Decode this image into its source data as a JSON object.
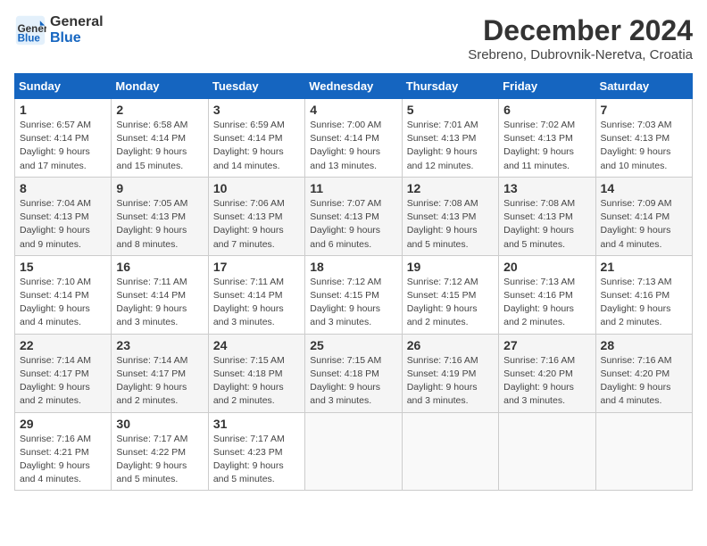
{
  "header": {
    "logo_line1": "General",
    "logo_line2": "Blue",
    "month": "December 2024",
    "location": "Srebreno, Dubrovnik-Neretva, Croatia"
  },
  "days_of_week": [
    "Sunday",
    "Monday",
    "Tuesday",
    "Wednesday",
    "Thursday",
    "Friday",
    "Saturday"
  ],
  "weeks": [
    [
      {
        "day": "1",
        "info": "Sunrise: 6:57 AM\nSunset: 4:14 PM\nDaylight: 9 hours\nand 17 minutes."
      },
      {
        "day": "2",
        "info": "Sunrise: 6:58 AM\nSunset: 4:14 PM\nDaylight: 9 hours\nand 15 minutes."
      },
      {
        "day": "3",
        "info": "Sunrise: 6:59 AM\nSunset: 4:14 PM\nDaylight: 9 hours\nand 14 minutes."
      },
      {
        "day": "4",
        "info": "Sunrise: 7:00 AM\nSunset: 4:14 PM\nDaylight: 9 hours\nand 13 minutes."
      },
      {
        "day": "5",
        "info": "Sunrise: 7:01 AM\nSunset: 4:13 PM\nDaylight: 9 hours\nand 12 minutes."
      },
      {
        "day": "6",
        "info": "Sunrise: 7:02 AM\nSunset: 4:13 PM\nDaylight: 9 hours\nand 11 minutes."
      },
      {
        "day": "7",
        "info": "Sunrise: 7:03 AM\nSunset: 4:13 PM\nDaylight: 9 hours\nand 10 minutes."
      }
    ],
    [
      {
        "day": "8",
        "info": "Sunrise: 7:04 AM\nSunset: 4:13 PM\nDaylight: 9 hours\nand 9 minutes."
      },
      {
        "day": "9",
        "info": "Sunrise: 7:05 AM\nSunset: 4:13 PM\nDaylight: 9 hours\nand 8 minutes."
      },
      {
        "day": "10",
        "info": "Sunrise: 7:06 AM\nSunset: 4:13 PM\nDaylight: 9 hours\nand 7 minutes."
      },
      {
        "day": "11",
        "info": "Sunrise: 7:07 AM\nSunset: 4:13 PM\nDaylight: 9 hours\nand 6 minutes."
      },
      {
        "day": "12",
        "info": "Sunrise: 7:08 AM\nSunset: 4:13 PM\nDaylight: 9 hours\nand 5 minutes."
      },
      {
        "day": "13",
        "info": "Sunrise: 7:08 AM\nSunset: 4:13 PM\nDaylight: 9 hours\nand 5 minutes."
      },
      {
        "day": "14",
        "info": "Sunrise: 7:09 AM\nSunset: 4:14 PM\nDaylight: 9 hours\nand 4 minutes."
      }
    ],
    [
      {
        "day": "15",
        "info": "Sunrise: 7:10 AM\nSunset: 4:14 PM\nDaylight: 9 hours\nand 4 minutes."
      },
      {
        "day": "16",
        "info": "Sunrise: 7:11 AM\nSunset: 4:14 PM\nDaylight: 9 hours\nand 3 minutes."
      },
      {
        "day": "17",
        "info": "Sunrise: 7:11 AM\nSunset: 4:14 PM\nDaylight: 9 hours\nand 3 minutes."
      },
      {
        "day": "18",
        "info": "Sunrise: 7:12 AM\nSunset: 4:15 PM\nDaylight: 9 hours\nand 3 minutes."
      },
      {
        "day": "19",
        "info": "Sunrise: 7:12 AM\nSunset: 4:15 PM\nDaylight: 9 hours\nand 2 minutes."
      },
      {
        "day": "20",
        "info": "Sunrise: 7:13 AM\nSunset: 4:16 PM\nDaylight: 9 hours\nand 2 minutes."
      },
      {
        "day": "21",
        "info": "Sunrise: 7:13 AM\nSunset: 4:16 PM\nDaylight: 9 hours\nand 2 minutes."
      }
    ],
    [
      {
        "day": "22",
        "info": "Sunrise: 7:14 AM\nSunset: 4:17 PM\nDaylight: 9 hours\nand 2 minutes."
      },
      {
        "day": "23",
        "info": "Sunrise: 7:14 AM\nSunset: 4:17 PM\nDaylight: 9 hours\nand 2 minutes."
      },
      {
        "day": "24",
        "info": "Sunrise: 7:15 AM\nSunset: 4:18 PM\nDaylight: 9 hours\nand 2 minutes."
      },
      {
        "day": "25",
        "info": "Sunrise: 7:15 AM\nSunset: 4:18 PM\nDaylight: 9 hours\nand 3 minutes."
      },
      {
        "day": "26",
        "info": "Sunrise: 7:16 AM\nSunset: 4:19 PM\nDaylight: 9 hours\nand 3 minutes."
      },
      {
        "day": "27",
        "info": "Sunrise: 7:16 AM\nSunset: 4:20 PM\nDaylight: 9 hours\nand 3 minutes."
      },
      {
        "day": "28",
        "info": "Sunrise: 7:16 AM\nSunset: 4:20 PM\nDaylight: 9 hours\nand 4 minutes."
      }
    ],
    [
      {
        "day": "29",
        "info": "Sunrise: 7:16 AM\nSunset: 4:21 PM\nDaylight: 9 hours\nand 4 minutes."
      },
      {
        "day": "30",
        "info": "Sunrise: 7:17 AM\nSunset: 4:22 PM\nDaylight: 9 hours\nand 5 minutes."
      },
      {
        "day": "31",
        "info": "Sunrise: 7:17 AM\nSunset: 4:23 PM\nDaylight: 9 hours\nand 5 minutes."
      },
      {
        "day": "",
        "info": ""
      },
      {
        "day": "",
        "info": ""
      },
      {
        "day": "",
        "info": ""
      },
      {
        "day": "",
        "info": ""
      }
    ]
  ]
}
